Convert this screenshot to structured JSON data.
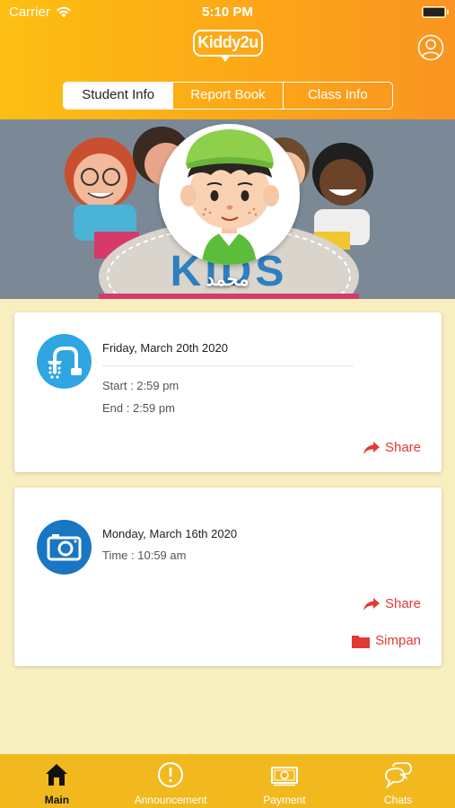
{
  "status_bar": {
    "carrier": "Carrier",
    "time": "5:10 PM"
  },
  "header": {
    "logo_text": "Kiddy2u",
    "tabs": [
      {
        "label": "Student Info",
        "active": true
      },
      {
        "label": "Report Book",
        "active": false
      },
      {
        "label": "Class Info",
        "active": false
      }
    ]
  },
  "banner": {
    "background_text": "KIDS ZONE",
    "student_name": "محمد"
  },
  "activities": [
    {
      "icon": "shower-icon",
      "date": "Friday, March 20th 2020",
      "start": "Start : 2:59 pm",
      "end": "End : 2:59 pm",
      "share_label": "Share"
    },
    {
      "icon": "camera-icon",
      "date": "Monday, March 16th 2020",
      "time": "Time : 10:59 am",
      "share_label": "Share",
      "save_label": "Simpan"
    }
  ],
  "tabbar": {
    "items": [
      {
        "label": "Main",
        "icon": "home-icon",
        "active": true
      },
      {
        "label": "Announcement",
        "icon": "alert-icon",
        "active": false
      },
      {
        "label": "Payment",
        "icon": "cash-icon",
        "active": false
      },
      {
        "label": "Chats",
        "icon": "chat-icon",
        "active": false
      }
    ]
  },
  "colors": {
    "header_start": "#fdbf13",
    "header_end": "#f99421",
    "tabbar": "#f2b91f",
    "accent_red": "#e53935",
    "shower_blue": "#2fa6e2",
    "camera_blue": "#1976c2"
  }
}
